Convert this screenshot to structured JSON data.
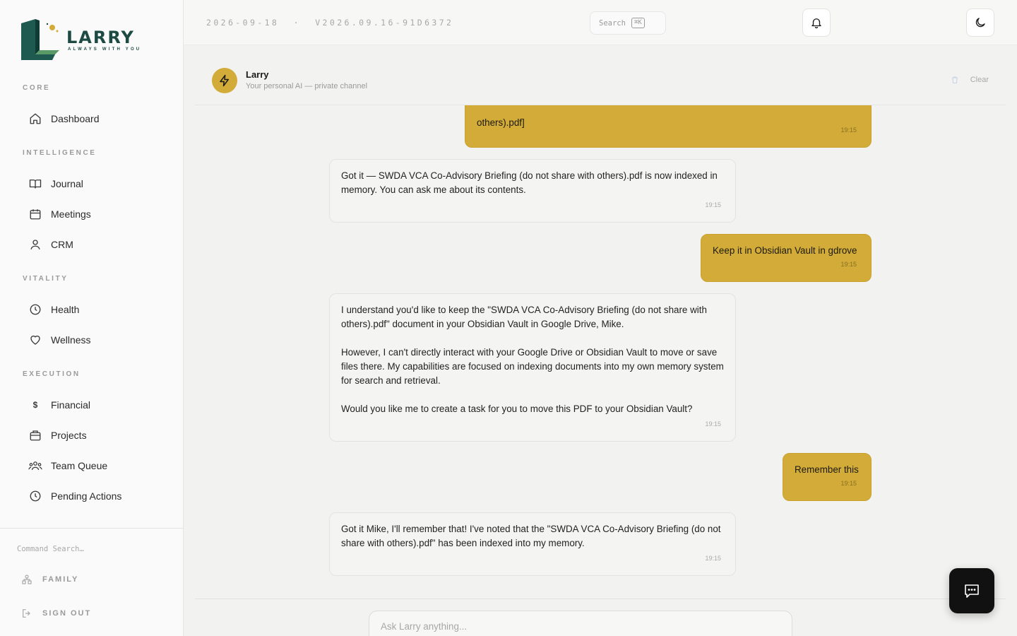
{
  "brand": {
    "name": "LARRY",
    "tagline": "ALWAYS WITH YOU"
  },
  "sidebar": {
    "sections": [
      {
        "title": "CORE",
        "items": [
          {
            "label": "Dashboard",
            "icon": "home-icon"
          }
        ]
      },
      {
        "title": "INTELLIGENCE",
        "items": [
          {
            "label": "Journal",
            "icon": "book-icon"
          },
          {
            "label": "Meetings",
            "icon": "calendar-icon"
          },
          {
            "label": "CRM",
            "icon": "user-icon"
          }
        ]
      },
      {
        "title": "VITALITY",
        "items": [
          {
            "label": "Health",
            "icon": "clock-icon"
          },
          {
            "label": "Wellness",
            "icon": "heart-icon"
          }
        ]
      },
      {
        "title": "EXECUTION",
        "items": [
          {
            "label": "Financial",
            "icon": "dollar-icon"
          },
          {
            "label": "Projects",
            "icon": "briefcase-icon"
          },
          {
            "label": "Team Queue",
            "icon": "team-icon"
          },
          {
            "label": "Pending Actions",
            "icon": "clock-icon"
          }
        ]
      }
    ],
    "command_search": "Command Search…",
    "family": "FAMILY",
    "sign_out": "SIGN OUT"
  },
  "topbar": {
    "date": "2026-09-18",
    "separator": "·",
    "version": "V2026.09.16-91D6372",
    "search_label": "Search",
    "search_shortcut": "⌘K"
  },
  "chat": {
    "name": "Larry",
    "subtitle": "Your personal AI — private channel",
    "clear_label": "Clear",
    "input_placeholder": "Ask Larry anything...",
    "messages": [
      {
        "role": "user",
        "paragraphs": [
          "others).pdf]"
        ],
        "time": "19:15"
      },
      {
        "role": "bot",
        "paragraphs": [
          "Got it — SWDA VCA Co-Advisory Briefing (do not share with others).pdf is now indexed in memory. You can ask me about its contents."
        ],
        "time": "19:15"
      },
      {
        "role": "user",
        "paragraphs": [
          "Keep it in Obsidian Vault in gdrove"
        ],
        "time": "19:15"
      },
      {
        "role": "bot",
        "paragraphs": [
          "I understand you'd like to keep the \"SWDA VCA Co-Advisory Briefing (do not share with others).pdf\" document in your Obsidian Vault in Google Drive, Mike.",
          "However, I can't directly interact with your Google Drive or Obsidian Vault to move or save files there. My capabilities are focused on indexing documents into my own memory system for search and retrieval.",
          "Would you like me to create a task for you to move this PDF to your Obsidian Vault?"
        ],
        "time": "19:15"
      },
      {
        "role": "user",
        "paragraphs": [
          "Remember this"
        ],
        "time": "19:15"
      },
      {
        "role": "bot",
        "paragraphs": [
          "Got it Mike, I'll remember that! I've noted that the \"SWDA VCA Co-Advisory Briefing (do not share with others).pdf\" has been indexed into my memory."
        ],
        "time": "19:15"
      }
    ]
  },
  "colors": {
    "accent": "#d2ab38",
    "brand": "#1e4a44",
    "fab": "#111111"
  }
}
